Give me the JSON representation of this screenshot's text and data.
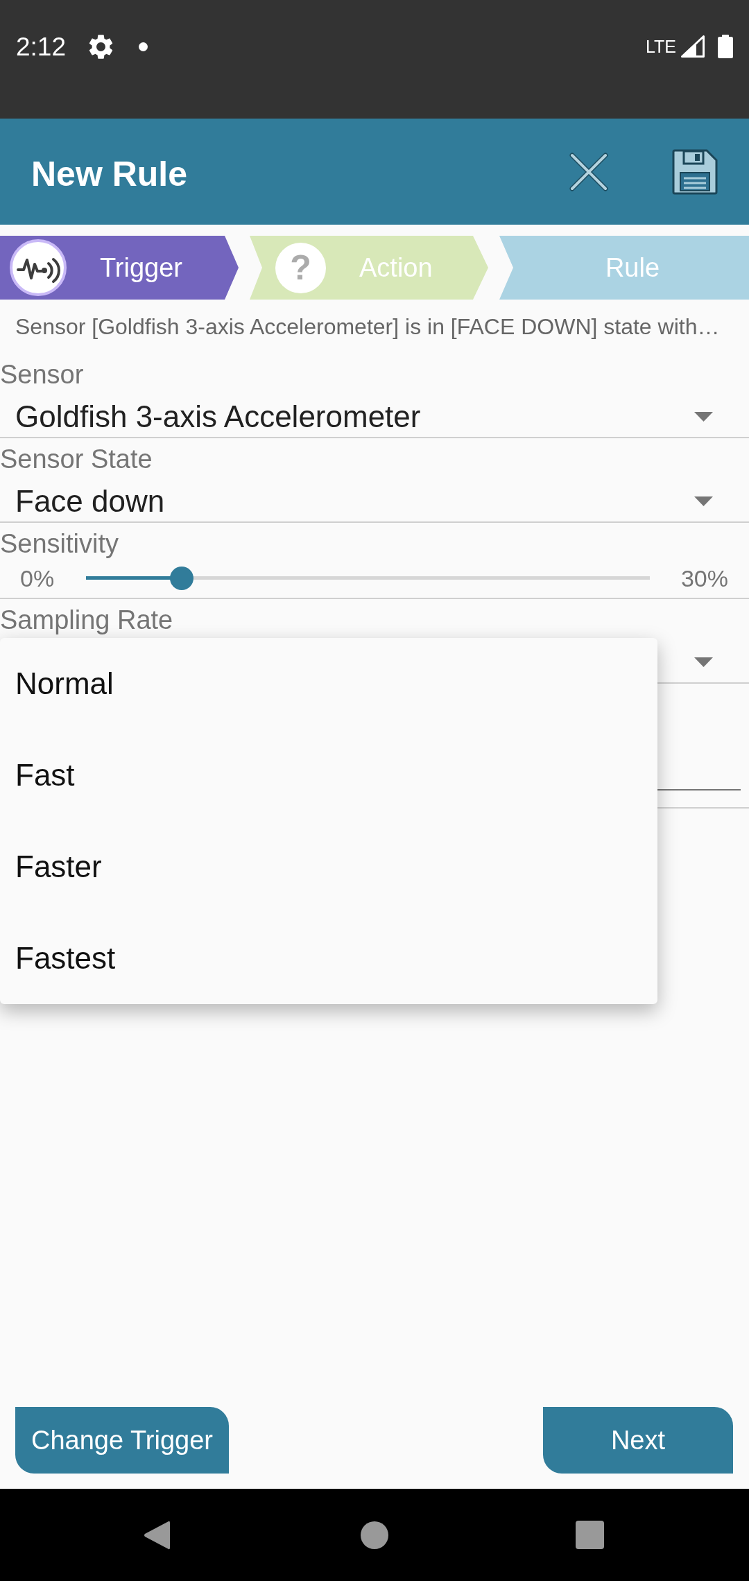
{
  "status_bar": {
    "time": "2:12",
    "network": "LTE"
  },
  "app_bar": {
    "title": "New Rule"
  },
  "steps": [
    {
      "label": "Trigger",
      "kind": "icon",
      "color": "#7365be"
    },
    {
      "label": "Action",
      "kind": "glyph",
      "glyph": "?",
      "color": "#d8e8b8"
    },
    {
      "label": "Rule",
      "kind": "plain",
      "color": "#abd3e3"
    }
  ],
  "summary": "Sensor [Goldfish 3-axis Accelerometer] is in [FACE DOWN] state with…",
  "fields": [
    {
      "kind": "select",
      "label": "Sensor",
      "value": "Goldfish 3-axis Accelerometer",
      "expanded": false
    },
    {
      "kind": "select",
      "label": "Sensor State",
      "value": "Face down",
      "expanded": false
    },
    {
      "kind": "slider",
      "label": "Sensitivity",
      "min_label": "0%",
      "max_label": "30%",
      "level": 0.17
    },
    {
      "kind": "select",
      "label": "Sampling Rate",
      "expanded": true,
      "options": [
        {
          "label": "Normal",
          "selected": false
        },
        {
          "label": "Fast",
          "selected": false
        },
        {
          "label": "Faster",
          "selected": false
        },
        {
          "label": "Fastest",
          "selected": false
        }
      ]
    }
  ],
  "buttons": [
    {
      "label": "Change Trigger"
    },
    {
      "label": "Next"
    }
  ]
}
